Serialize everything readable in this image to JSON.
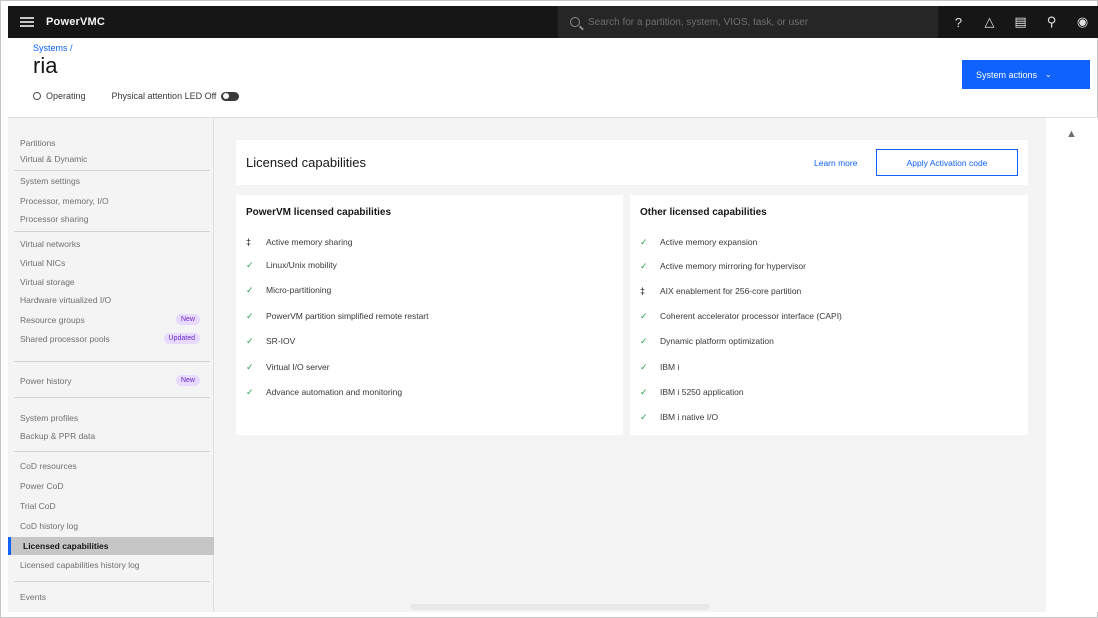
{
  "topbar": {
    "app_name": "PowerVMC",
    "search_placeholder": "Search for a partition, system, VIOS, task, or user",
    "icons": [
      "help-icon",
      "notification-icon",
      "document-icon",
      "pin-icon",
      "user-icon"
    ]
  },
  "header": {
    "breadcrumb": "Systems /",
    "title": "ria",
    "status": "Operating",
    "toggle_label": "Physical attention LED Off",
    "actions_button": "System actions"
  },
  "sidebar": {
    "items": [
      {
        "label": "Partitions"
      },
      {
        "label": "Virtual & Dynamic"
      },
      {
        "label": "System settings"
      },
      {
        "label": "Processor, memory, I/O"
      },
      {
        "label": "Processor sharing"
      },
      {
        "label": "Virtual networks"
      },
      {
        "label": "Virtual NICs"
      },
      {
        "label": "Virtual storage"
      },
      {
        "label": "Hardware virtualized I/O"
      },
      {
        "label": "Resource groups",
        "tag": "New"
      },
      {
        "label": "Shared processor pools",
        "tag": "Updated"
      },
      {
        "label": "Power history",
        "tag": "New"
      },
      {
        "label": "System profiles"
      },
      {
        "label": "Backup & PPR data"
      },
      {
        "label": "CoD resources"
      },
      {
        "label": "Power CoD"
      },
      {
        "label": "Trial CoD"
      },
      {
        "label": "CoD history log"
      },
      {
        "label": "Licensed capabilities"
      },
      {
        "label": "Licensed capabilities history log"
      },
      {
        "label": "Events"
      }
    ]
  },
  "main": {
    "card_title": "Licensed capabilities",
    "learn_more": "Learn more",
    "apply_button": "Apply Activation code",
    "left_panel": {
      "title": "PowerVM licensed capabilities",
      "items": [
        {
          "label": "Active memory sharing",
          "icon": "lock-icon"
        },
        {
          "label": "Linux/Unix mobility",
          "icon": "checkmark-icon"
        },
        {
          "label": "Micro-partitioning",
          "icon": "checkmark-icon"
        },
        {
          "label": "PowerVM partition simplified remote restart",
          "icon": "checkmark-icon"
        },
        {
          "label": "SR-IOV",
          "icon": "checkmark-icon"
        },
        {
          "label": "Virtual I/O server",
          "icon": "checkmark-icon"
        },
        {
          "label": "Advance automation and monitoring",
          "icon": "checkmark-icon"
        }
      ]
    },
    "right_panel": {
      "title": "Other licensed capabilities",
      "items": [
        {
          "label": "Active memory expansion",
          "icon": "checkmark-icon"
        },
        {
          "label": "Active memory mirroring for hypervisor",
          "icon": "checkmark-icon"
        },
        {
          "label": "AIX enablement for 256-core partition",
          "icon": "lock-icon"
        },
        {
          "label": "Coherent accelerator processor interface (CAPI)",
          "icon": "checkmark-icon"
        },
        {
          "label": "Dynamic platform optimization",
          "icon": "checkmark-icon"
        },
        {
          "label": "IBM i",
          "icon": "checkmark-icon"
        },
        {
          "label": "IBM i 5250 application",
          "icon": "checkmark-icon"
        },
        {
          "label": "IBM i native I/O",
          "icon": "checkmark-icon"
        }
      ]
    }
  },
  "colors": {
    "accent": "#0f62fe",
    "topbar": "#161616",
    "success": "#24a148",
    "sidebar_bg": "#f4f4f4"
  }
}
